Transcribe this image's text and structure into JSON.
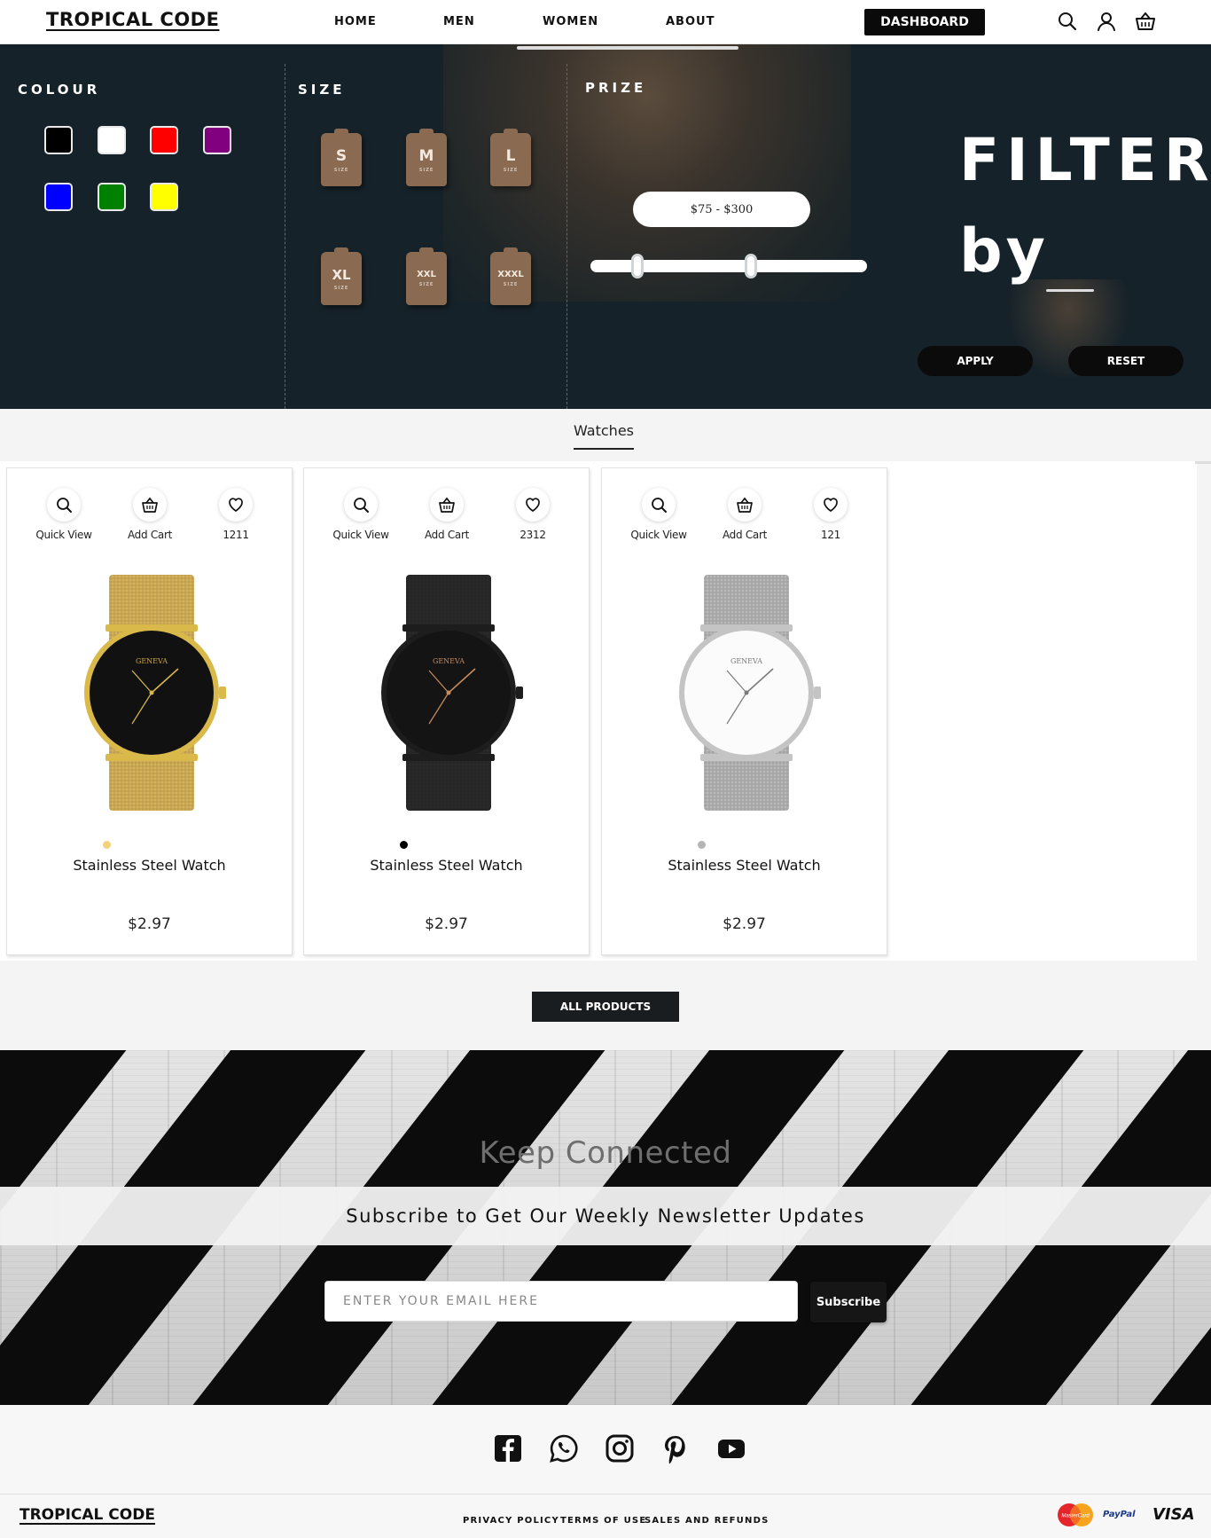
{
  "header": {
    "logo": "TROPICAL CODE",
    "nav": [
      "HOME",
      "MEN",
      "WOMEN",
      "ABOUT"
    ],
    "dashboard": "DASHBOARD",
    "icons": [
      "search-icon",
      "user-icon",
      "basket-icon"
    ]
  },
  "filter": {
    "colour_label": "COLOUR",
    "size_label": "SIZE",
    "price_label": "PRIZE",
    "colours": [
      "#000000",
      "#ffffff",
      "#ff0000",
      "#800080",
      "#0000ff",
      "#008000",
      "#ffff00"
    ],
    "sizes": [
      "S",
      "M",
      "L",
      "XL",
      "XXL",
      "XXXL"
    ],
    "size_sub": "SIZE",
    "price_range": "$75 - $300",
    "slider_low": 0.17,
    "slider_high": 0.58,
    "title": "FILTER",
    "title2": "by",
    "apply": "APPLY",
    "reset": "RESET"
  },
  "category": "Watches",
  "actions": {
    "quick_view": "Quick View",
    "add_cart": "Add Cart"
  },
  "products": [
    {
      "name": "Stainless Steel Watch",
      "price": "$2.97",
      "likes": "1211",
      "dot": "#f2d27a",
      "brand": "GENEVA",
      "band": "#d6b35a",
      "bezel": "#d8b94a",
      "face": "#111111"
    },
    {
      "name": "Stainless Steel Watch",
      "price": "$2.97",
      "likes": "2312",
      "dot": "#000000",
      "brand": "GENEVA",
      "band": "#2a2a2a",
      "bezel": "#1d1d1d",
      "face": "#141414"
    },
    {
      "name": "Stainless Steel Watch",
      "price": "$2.97",
      "likes": "121",
      "dot": "#b5b5b5",
      "brand": "GENEVA",
      "band": "#b9b9b9",
      "bezel": "#c4c4c4",
      "face": "#fbfbfb"
    }
  ],
  "all_products": "ALL PRODUCTS",
  "newsletter": {
    "keep": "Keep Connected",
    "headline": "Subscribe to Get Our Weekly Newsletter Updates",
    "placeholder": "ENTER YOUR EMAIL HERE",
    "button": "Subscribe"
  },
  "footer": {
    "social": [
      "facebook-icon",
      "whatsapp-icon",
      "instagram-icon",
      "pinterest-icon",
      "youtube-icon"
    ],
    "logo": "TROPICAL CODE",
    "links": [
      "PRIVACY POLICY",
      "TERMS OF USE",
      "SALES AND REFUNDS"
    ],
    "payments": {
      "mastercard": "MasterCard",
      "paypal": "PayPal",
      "visa": "VISA"
    }
  }
}
